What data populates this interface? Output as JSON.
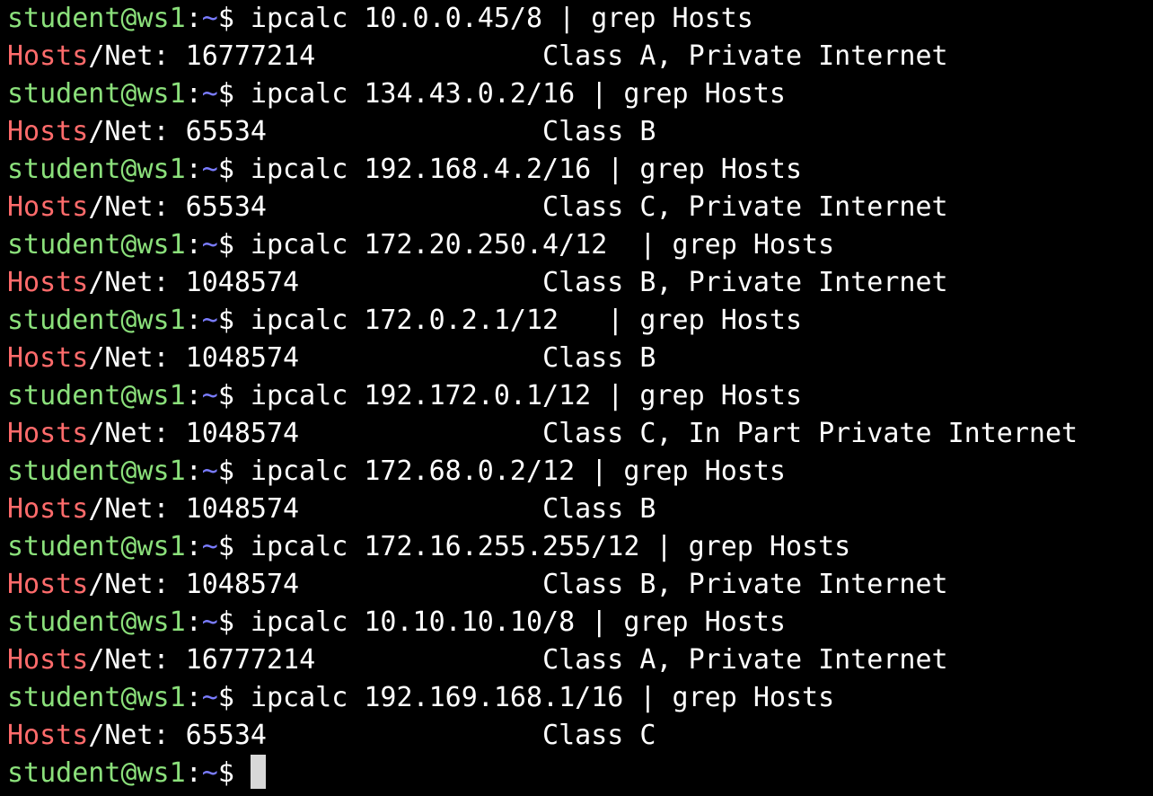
{
  "prompt": {
    "user_host": "student@ws1",
    "colon": ":",
    "path": "~",
    "dollar": "$"
  },
  "entries": [
    {
      "command": " ipcalc 10.0.0.45/8 | grep Hosts",
      "match": "Hosts",
      "rest": "/Net: 16777214",
      "class_info": "Class A, Private Internet"
    },
    {
      "command": " ipcalc 134.43.0.2/16 | grep Hosts",
      "match": "Hosts",
      "rest": "/Net: 65534",
      "class_info": "Class B"
    },
    {
      "command": " ipcalc 192.168.4.2/16 | grep Hosts",
      "match": "Hosts",
      "rest": "/Net: 65534",
      "class_info": "Class C, Private Internet"
    },
    {
      "command": " ipcalc 172.20.250.4/12  | grep Hosts",
      "match": "Hosts",
      "rest": "/Net: 1048574",
      "class_info": "Class B, Private Internet"
    },
    {
      "command": " ipcalc 172.0.2.1/12   | grep Hosts",
      "match": "Hosts",
      "rest": "/Net: 1048574",
      "class_info": "Class B"
    },
    {
      "command": " ipcalc 192.172.0.1/12 | grep Hosts",
      "match": "Hosts",
      "rest": "/Net: 1048574",
      "class_info": "Class C, In Part Private Internet"
    },
    {
      "command": " ipcalc 172.68.0.2/12 | grep Hosts",
      "match": "Hosts",
      "rest": "/Net: 1048574",
      "class_info": "Class B"
    },
    {
      "command": " ipcalc 172.16.255.255/12 | grep Hosts",
      "match": "Hosts",
      "rest": "/Net: 1048574",
      "class_info": "Class B, Private Internet"
    },
    {
      "command": " ipcalc 10.10.10.10/8 | grep Hosts",
      "match": "Hosts",
      "rest": "/Net: 16777214",
      "class_info": "Class A, Private Internet"
    },
    {
      "command": " ipcalc 192.169.168.1/16 | grep Hosts",
      "match": "Hosts",
      "rest": "/Net: 65534",
      "class_info": "Class C"
    }
  ],
  "colors": {
    "background": "#000000",
    "prompt_user": "#8be07b",
    "prompt_path": "#7a7cff",
    "grep_match": "#ff6b6b",
    "text": "#ffffff",
    "cursor": "#d8d8d8"
  }
}
